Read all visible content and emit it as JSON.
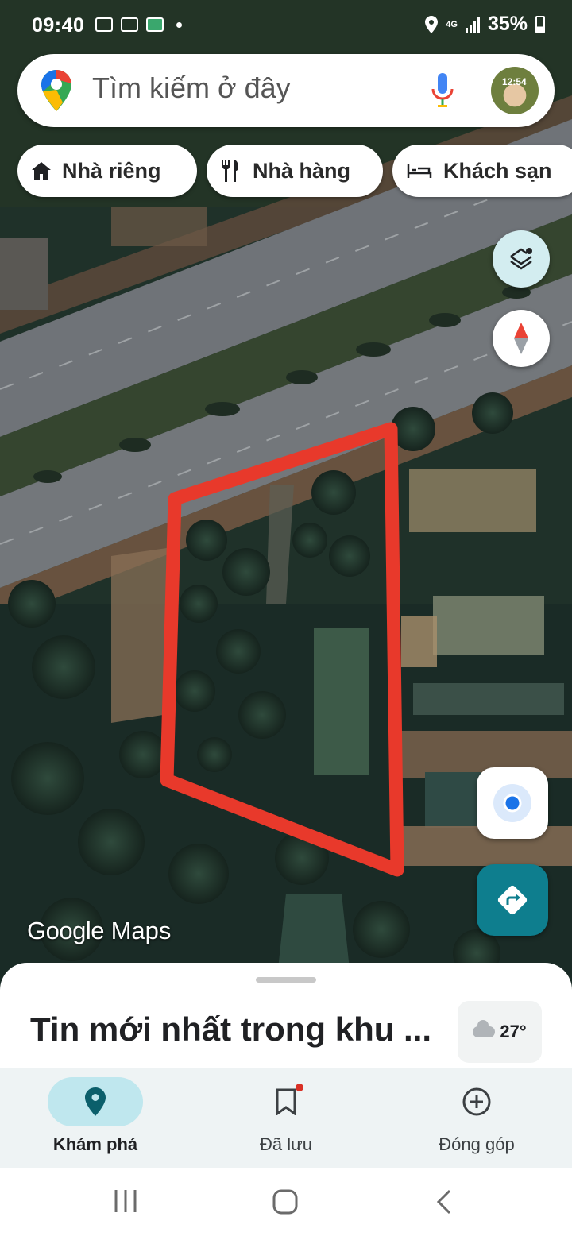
{
  "status_bar": {
    "time": "09:40",
    "battery": "35%",
    "network": "4G",
    "icons": [
      "video-icon",
      "image-icon",
      "check-icon",
      "dot-icon",
      "location-icon",
      "signal-icon",
      "battery-icon"
    ]
  },
  "search": {
    "placeholder": "Tìm kiếm ở đây",
    "avatar_text": "12:54"
  },
  "chips": [
    {
      "label": "Nhà riêng",
      "icon": "home-icon"
    },
    {
      "label": "Nhà hàng",
      "icon": "restaurant-icon"
    },
    {
      "label": "Khách sạn",
      "icon": "hotel-icon"
    }
  ],
  "map": {
    "watermark_google": "Google",
    "watermark_maps": "Maps",
    "annotation_color": "#e8392b"
  },
  "sheet": {
    "title": "Tin mới nhất trong khu ...",
    "weather": "27°"
  },
  "bottom_nav": [
    {
      "label": "Khám phá",
      "icon": "explore-pin-icon",
      "active": true
    },
    {
      "label": "Đã lưu",
      "icon": "bookmark-icon",
      "active": false
    },
    {
      "label": "Đóng góp",
      "icon": "add-circle-icon",
      "active": false
    }
  ],
  "colors": {
    "accent": "#0e7e8e",
    "active_pill": "#bfe7ee",
    "location_blue": "#1a73e8"
  }
}
